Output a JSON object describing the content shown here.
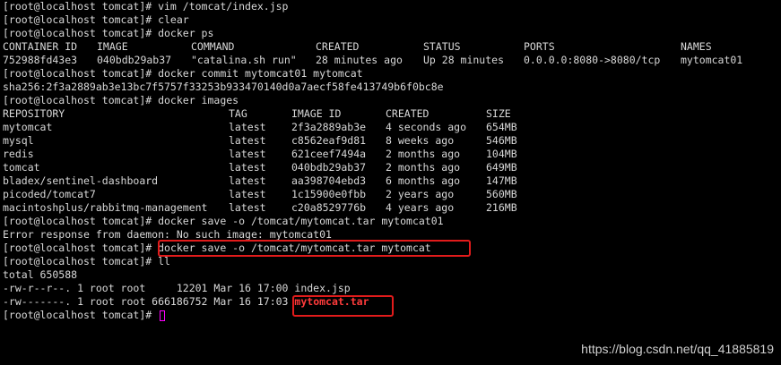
{
  "terminal": {
    "lines": [
      "[root@localhost tomcat]# vim /tomcat/index.jsp",
      "[root@localhost tomcat]# clear",
      "[root@localhost tomcat]# docker ps"
    ],
    "docker_ps": {
      "headers": [
        "CONTAINER ID",
        "IMAGE",
        "COMMAND",
        "CREATED",
        "STATUS",
        "PORTS",
        "NAMES"
      ],
      "rows": [
        [
          "752988fd43e3",
          "040bdb29ab37",
          "\"catalina.sh run\"",
          "28 minutes ago",
          "Up 28 minutes",
          "0.0.0.0:8080->8080/tcp",
          "mytomcat01"
        ]
      ]
    },
    "commit_cmd": "[root@localhost tomcat]# docker commit mytomcat01 mytomcat",
    "commit_hash": "sha256:2f3a2889ab3e13bc7f5757f33253b933470140d0a7aecf58fe413749b6f0bc8e",
    "images_cmd": "[root@localhost tomcat]# docker images",
    "docker_images": {
      "headers": [
        "REPOSITORY",
        "TAG",
        "IMAGE ID",
        "CREATED",
        "SIZE"
      ],
      "rows": [
        [
          "mytomcat",
          "latest",
          "2f3a2889ab3e",
          "4 seconds ago",
          "654MB"
        ],
        [
          "mysql",
          "latest",
          "c8562eaf9d81",
          "8 weeks ago",
          "546MB"
        ],
        [
          "redis",
          "latest",
          "621ceef7494a",
          "2 months ago",
          "104MB"
        ],
        [
          "tomcat",
          "latest",
          "040bdb29ab37",
          "2 months ago",
          "649MB"
        ],
        [
          "bladex/sentinel-dashboard",
          "latest",
          "aa398704ebd3",
          "6 months ago",
          "147MB"
        ],
        [
          "picoded/tomcat7",
          "latest",
          "1c15900e0fbb",
          "2 years ago",
          "560MB"
        ],
        [
          "macintoshplus/rabbitmq-management",
          "latest",
          "c20a8529776b",
          "4 years ago",
          "216MB"
        ]
      ]
    },
    "save_cmd_1": "[root@localhost tomcat]# docker save -o /tomcat/mytomcat.tar mytomcat01",
    "error_line": "Error response from daemon: No such image: mytomcat01",
    "prompt": "[root@localhost tomcat]# ",
    "save_cmd_2": "docker save -o /tomcat/mytomcat.tar mytomcat",
    "ll_cmd": "[root@localhost tomcat]# ll",
    "total_line": "total 650588",
    "file1": "-rw-r--r--. 1 root root     12201 Mar 16 17:00 index.jsp",
    "file2_prefix": "-rw-------. 1 root root 666186752 Mar 16 17:03 ",
    "file2_name": "mytomcat.tar",
    "last_prompt": "[root@localhost tomcat]# "
  },
  "watermark": "https://blog.csdn.net/qq_41885819",
  "colors": {
    "background": "#000000",
    "text": "#d8d8d8",
    "highlight": "#e11b1b",
    "file_highlight": "#ff3b3b"
  }
}
